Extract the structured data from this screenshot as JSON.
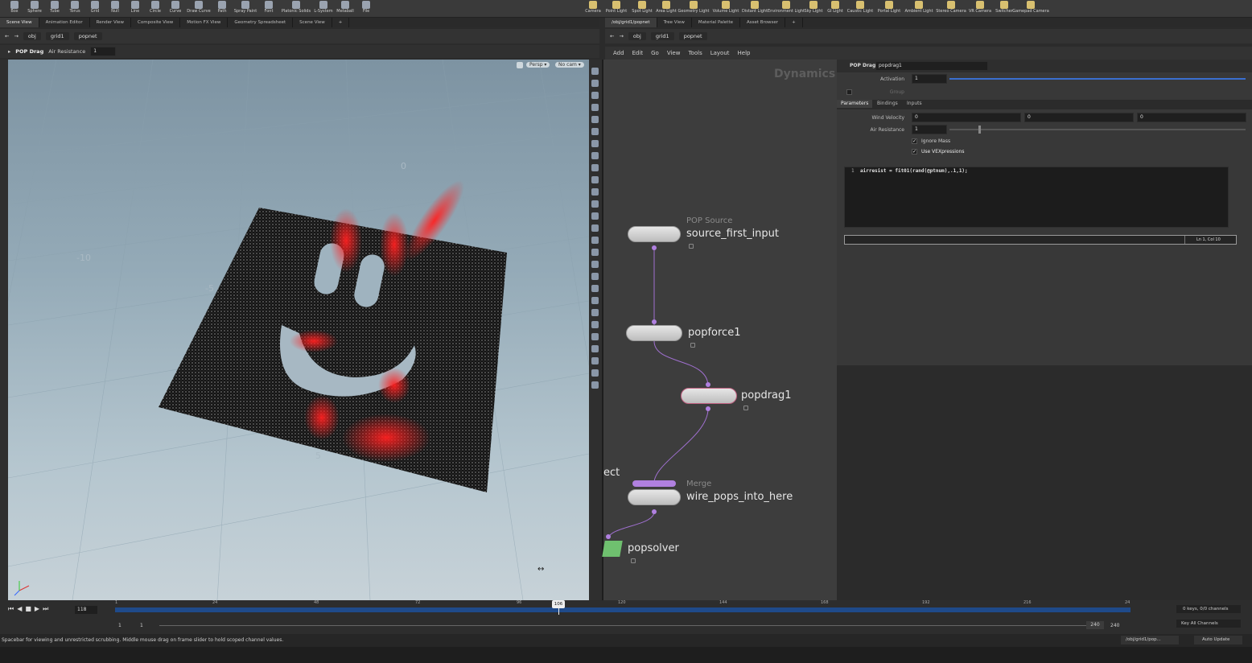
{
  "shelf": {
    "left_tools": [
      "Box",
      "Sphere",
      "Tube",
      "Torus",
      "Grid",
      "Null",
      "Line",
      "Circle",
      "Curve",
      "Draw Curve",
      "Path",
      "Spray Paint",
      "Font",
      "Platonic Solids",
      "L-System",
      "Metaball",
      "File"
    ],
    "right_tools": [
      "Camera",
      "Point Light",
      "Spot Light",
      "Area Light",
      "Geometry Light",
      "Volume Light",
      "Distant Light",
      "Environment Light",
      "Sky Light",
      "GI Light",
      "Caustic Light",
      "Portal Light",
      "Ambient Light",
      "Stereo Camera",
      "VR Camera",
      "Switcher",
      "Gamepad Camera"
    ]
  },
  "left_tabs": [
    "Scene View",
    "Animation Editor",
    "Render View",
    "Composite View",
    "Motion FX View",
    "Geometry Spreadsheet",
    "Scene View"
  ],
  "right_tabs": [
    "/obj/grid1/popnet",
    "Tree View",
    "Material Palette",
    "Asset Browser"
  ],
  "left_path": {
    "obj": "obj",
    "grid": "grid1",
    "net": "popnet"
  },
  "right_path": {
    "obj": "obj",
    "grid": "grid1",
    "net": "popnet"
  },
  "viewport": {
    "op_label": "POP Drag",
    "param_label": "Air Resistance",
    "param_value": "1",
    "persp": "Persp ▾",
    "cam": "No cam ▾",
    "grid_numbers": [
      "-10",
      "-5",
      "0",
      "5"
    ]
  },
  "network": {
    "menu": [
      "Add",
      "Edit",
      "Go",
      "View",
      "Tools",
      "Layout",
      "Help"
    ],
    "context_label": "Dynamics",
    "nodes": {
      "source": {
        "type": "POP Source",
        "name": "source_first_input"
      },
      "force": {
        "name": "popforce1"
      },
      "drag": {
        "name": "popdrag1"
      },
      "merge": {
        "type": "Merge",
        "name": "wire_pops_into_here"
      },
      "solver": {
        "name": "popsolver"
      },
      "object_partial": "ect"
    }
  },
  "params": {
    "op_type": "POP Drag",
    "op_name": "popdrag1",
    "activation_label": "Activation",
    "activation_value": "1",
    "group_label": "Group",
    "tabs": [
      "Parameters",
      "Bindings",
      "Inputs"
    ],
    "wind_label": "Wind Velocity",
    "wind_values": [
      "0",
      "0",
      "0"
    ],
    "air_label": "Air Resistance",
    "air_value": "1",
    "ignore_mass": "Ignore Mass",
    "use_vex": "Use VEXpressions",
    "code_line_no": "1",
    "code": "airresist = fit01(rand(@ptnum),.1,1);",
    "cursor_pos": "Ln 1, Col 10"
  },
  "timeline": {
    "frame": "118",
    "current_marker": "106",
    "ticks": [
      "1",
      "24",
      "48",
      "72",
      "96",
      "120",
      "144",
      "168",
      "192",
      "216",
      "24"
    ],
    "range_start": "1",
    "range_start2": "1",
    "range_end": "240",
    "range_end2": "240",
    "keys_info": "0 keys, 0/0 channels",
    "key_all": "Key All Channels"
  },
  "status": {
    "message": "Spacebar for viewing and unrestricted scrubbing. Middle mouse drag on frame slider to hold scoped channel values.",
    "path": "/obj/grid1/pop...",
    "update": "Auto Update"
  },
  "colors": {
    "particle_red": "#ff1a1a",
    "node_wire": "#a070d0",
    "viewport_top": "#7d93a2"
  }
}
